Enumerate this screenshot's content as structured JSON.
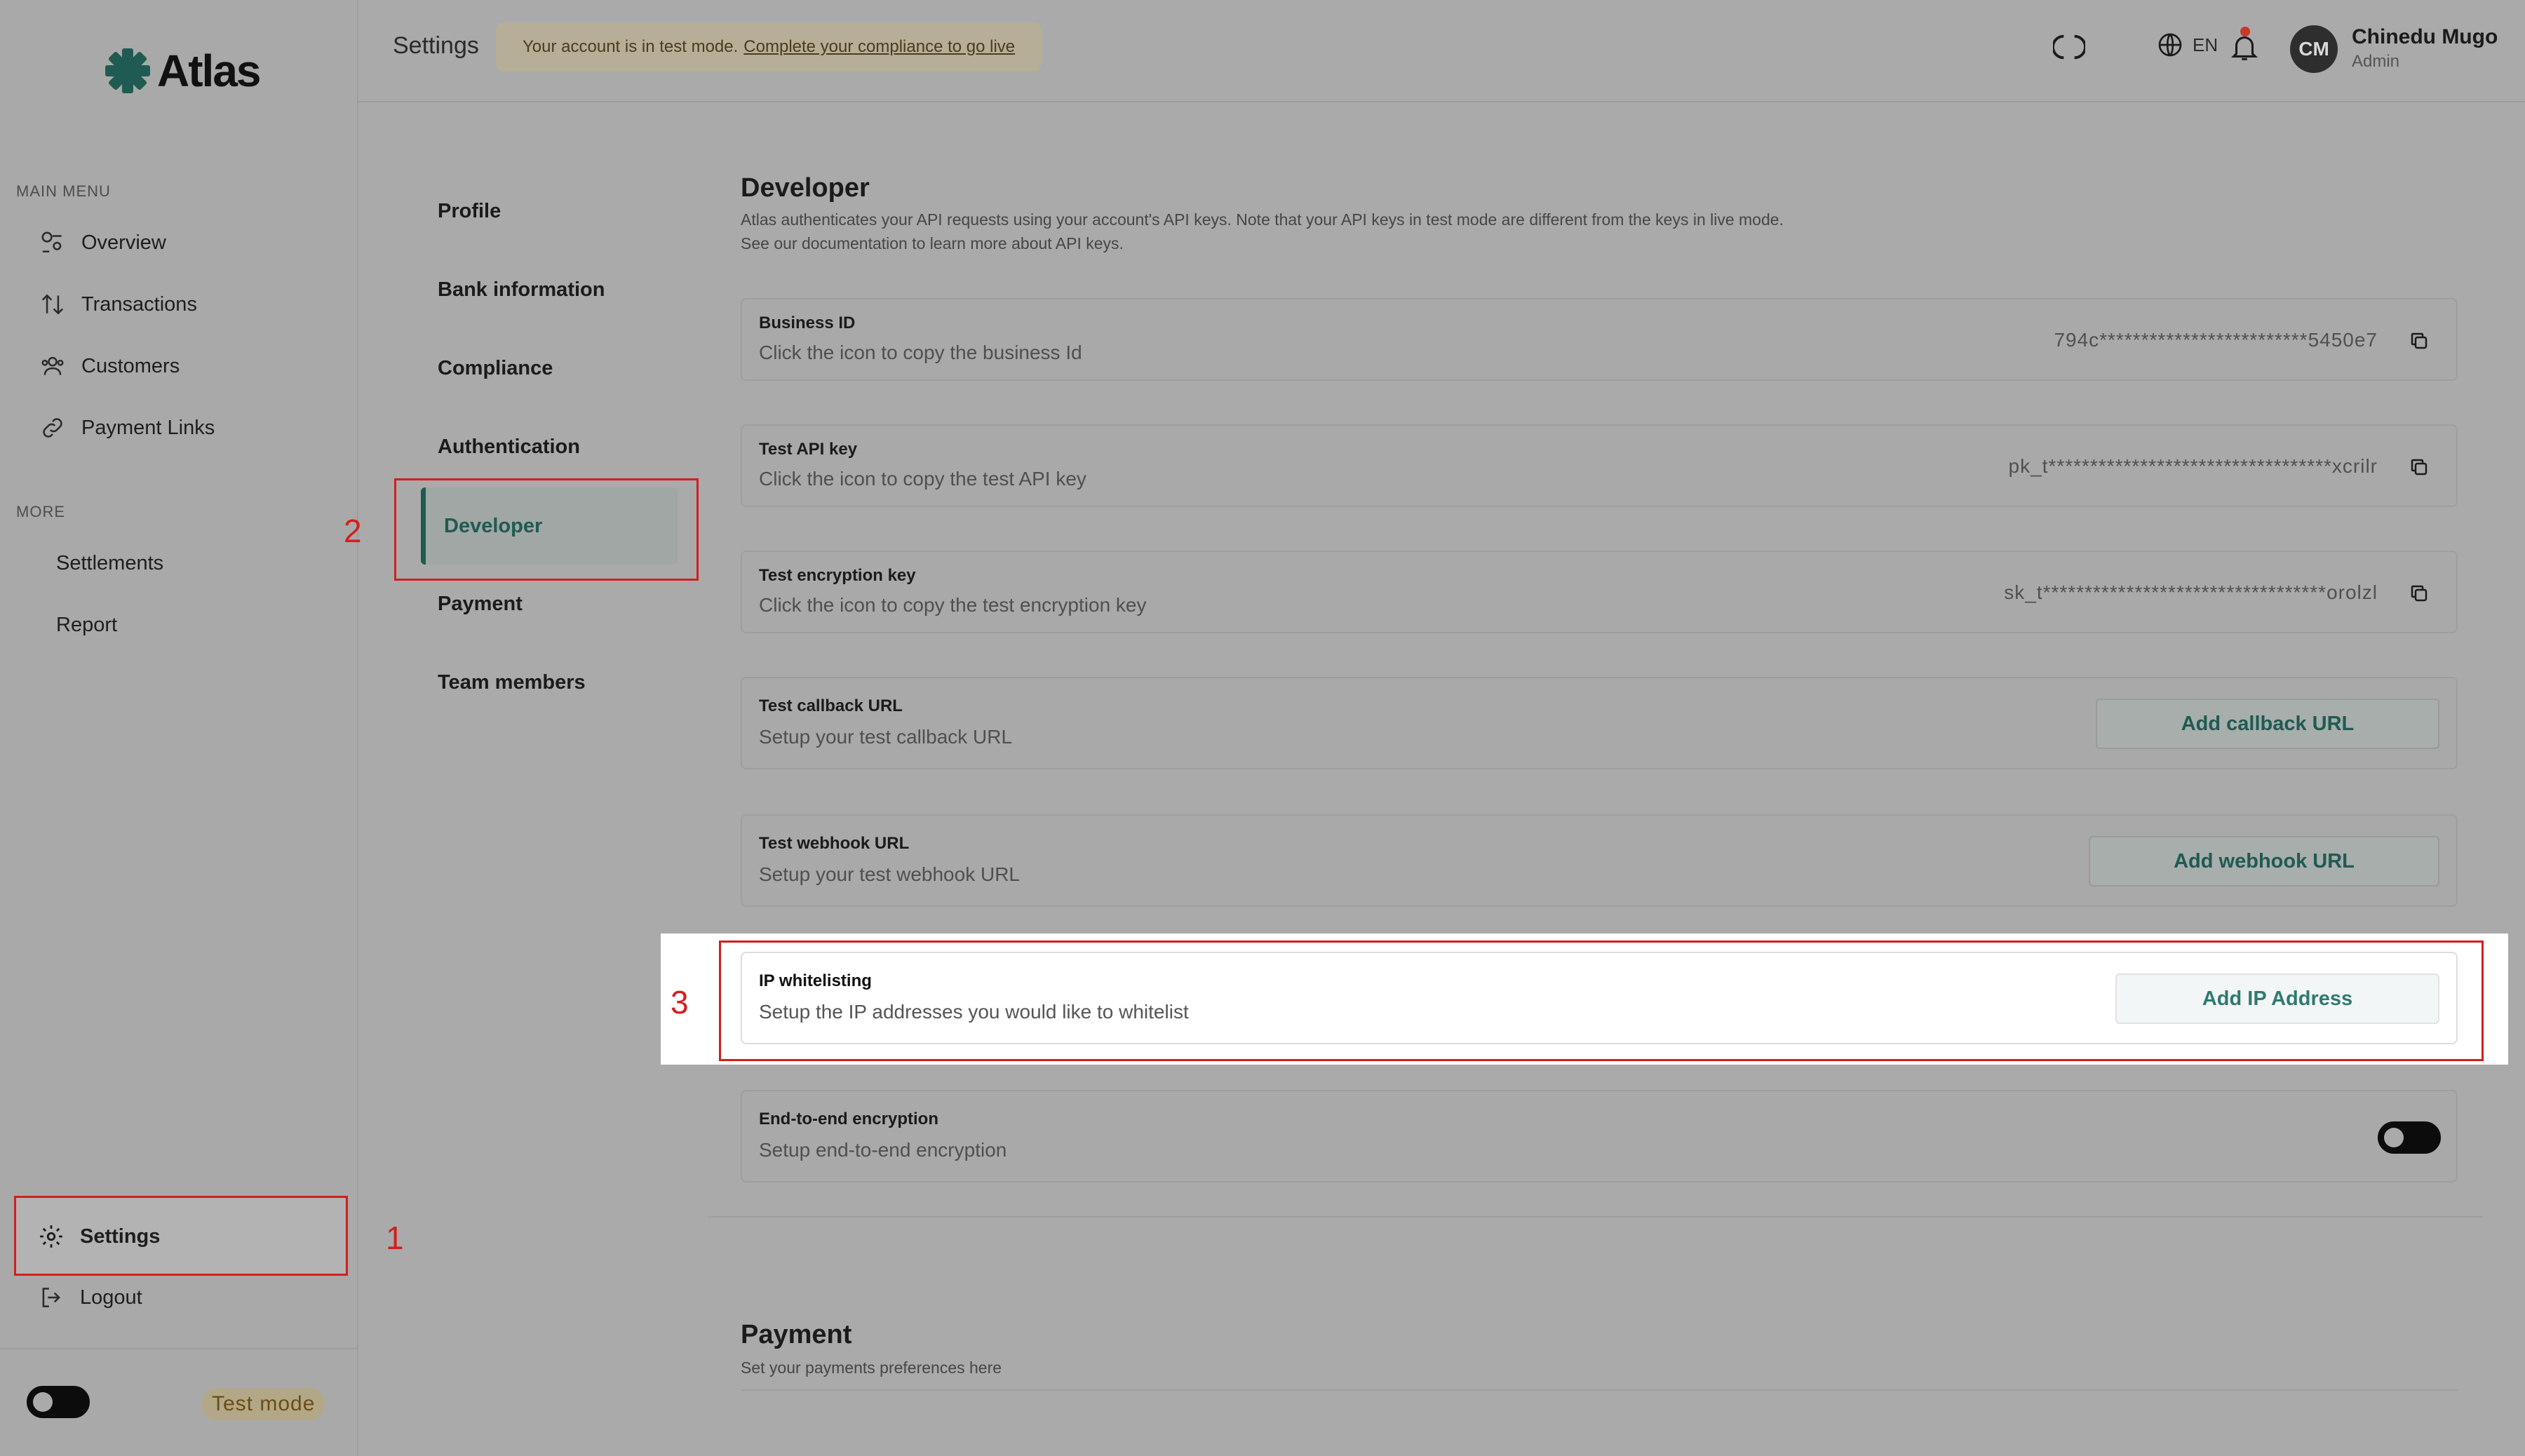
{
  "app": {
    "name": "Atlas"
  },
  "header": {
    "title": "Settings",
    "banner_text": "Your account is in test mode.",
    "banner_link": "Complete your compliance to go live",
    "language": "EN",
    "user": {
      "initials": "CM",
      "name": "Chinedu Mugo",
      "role": "Admin"
    }
  },
  "sidebar": {
    "main_menu_label": "MAIN MENU",
    "main_items": [
      {
        "label": "Overview",
        "icon": "overview-icon"
      },
      {
        "label": "Transactions",
        "icon": "transactions-icon"
      },
      {
        "label": "Customers",
        "icon": "customers-icon"
      },
      {
        "label": "Payment Links",
        "icon": "link-icon"
      }
    ],
    "more_label": "MORE",
    "more_items": [
      {
        "label": "Settlements"
      },
      {
        "label": "Report"
      }
    ],
    "settings_label": "Settings",
    "logout_label": "Logout",
    "test_mode_label": "Test mode"
  },
  "settings_nav": {
    "items": [
      "Profile",
      "Bank information",
      "Compliance",
      "Authentication",
      "Developer",
      "Payment",
      "Team members"
    ],
    "active": "Developer"
  },
  "developer": {
    "title": "Developer",
    "desc_line1": "Atlas authenticates your API requests using your account's API keys. Note that your API keys in test mode are different from the keys in live mode.",
    "desc_line2": "See our documentation to learn more about API keys.",
    "business_id": {
      "label": "Business ID",
      "sub": "Click the icon to copy the business Id",
      "value": "794c*************************5450e7"
    },
    "test_api_key": {
      "label": "Test API key",
      "sub": "Click the icon to copy the test API key",
      "value": "pk_t**********************************xcrilr"
    },
    "test_encryption_key": {
      "label": "Test encryption key",
      "sub": "Click the icon to copy the test encryption key",
      "value": "sk_t**********************************orolzl"
    },
    "callback": {
      "label": "Test callback URL",
      "sub": "Setup your test callback URL",
      "button": "Add callback URL"
    },
    "webhook": {
      "label": "Test webhook URL",
      "sub": "Setup your test webhook URL",
      "button": "Add webhook URL"
    },
    "ip_whitelisting": {
      "label": "IP whitelisting",
      "sub": "Setup the IP addresses you would like to whitelist",
      "button": "Add IP Address"
    },
    "e2e": {
      "label": "End-to-end encryption",
      "sub": "Setup end-to-end encryption"
    }
  },
  "payment_section": {
    "title": "Payment",
    "desc": "Set your payments preferences here"
  },
  "annotations": {
    "n1": "1",
    "n2": "2",
    "n3": "3"
  },
  "colors": {
    "accent": "#1f5b52",
    "annotation": "#d11f1f",
    "banner": "#b6ae97"
  }
}
